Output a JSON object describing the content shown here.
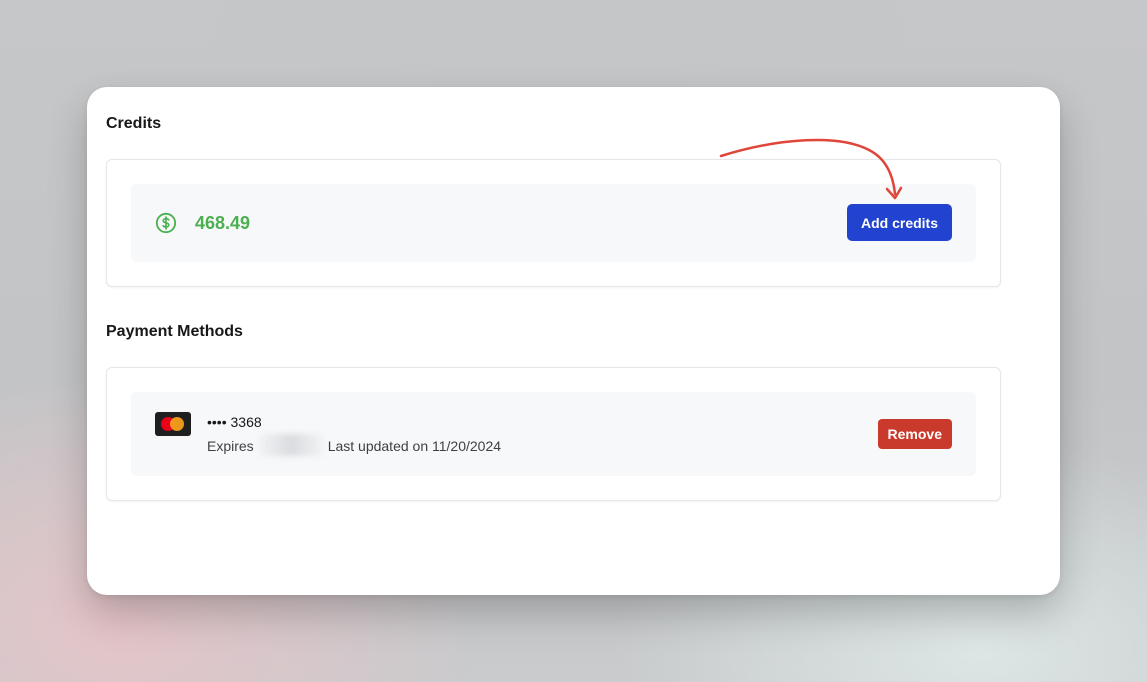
{
  "credits": {
    "section_title": "Credits",
    "amount": "468.49",
    "icon": "dollar-circle-icon",
    "add_button_label": "Add credits"
  },
  "payment_methods": {
    "section_title": "Payment Methods",
    "cards": [
      {
        "brand_icon": "mastercard-icon",
        "masked_number": "•••• 3368",
        "expires_label": "Expires",
        "last_updated": "Last updated on 11/20/2024",
        "remove_label": "Remove"
      }
    ]
  },
  "colors": {
    "accent": "#2243cf",
    "amount_green": "#4caf50",
    "danger": "#c93a2c",
    "annotation_arrow": "#e0453a"
  }
}
